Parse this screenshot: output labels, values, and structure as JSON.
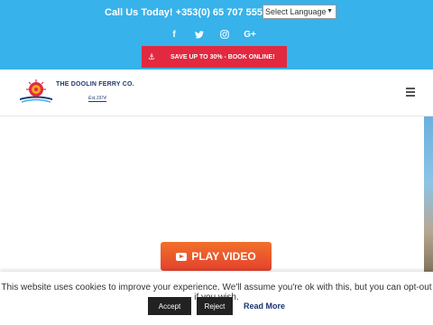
{
  "topbar": {
    "call_text": "Call Us Today! +353(0) 65 707 5555",
    "language_select": "Select Language",
    "social_icons": [
      "facebook-icon",
      "twitter-icon",
      "instagram-icon",
      "google-plus-icon"
    ],
    "promo_text": "SAVE UP TO 30% - BOOK ONLINE!"
  },
  "header": {
    "logo_name": "THE DOOLIN FERRY CO.",
    "logo_est": "Est.1974"
  },
  "hero": {
    "play_label": "PLAY VIDEO"
  },
  "cookie": {
    "message": "This website uses cookies to improve your experience. We'll assume you're ok with this, but you can opt-out if you wish.",
    "accept_label": "Accept",
    "reject_label": "Reject",
    "read_more_label": "Read More"
  },
  "colors": {
    "topbar_bg": "#37b2ea",
    "promo_bg": "#e2293f",
    "play_button": "#e85a2b",
    "brand_navy": "#1f3b72"
  }
}
